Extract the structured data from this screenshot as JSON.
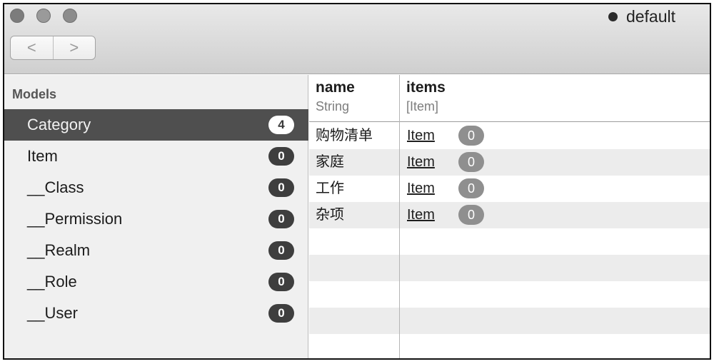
{
  "window": {
    "realm_name": "default"
  },
  "toolbar": {
    "back_glyph": "<",
    "forward_glyph": ">"
  },
  "sidebar": {
    "title": "Models",
    "models": [
      {
        "label": "Category",
        "count": "4",
        "selected": true
      },
      {
        "label": "Item",
        "count": "0",
        "selected": false
      },
      {
        "label": "__Class",
        "count": "0",
        "selected": false
      },
      {
        "label": "__Permission",
        "count": "0",
        "selected": false
      },
      {
        "label": "__Realm",
        "count": "0",
        "selected": false
      },
      {
        "label": "__Role",
        "count": "0",
        "selected": false
      },
      {
        "label": "__User",
        "count": "0",
        "selected": false
      }
    ]
  },
  "table": {
    "columns": [
      {
        "name": "name",
        "type": "String"
      },
      {
        "name": "items",
        "type": "[Item]"
      }
    ],
    "rows": [
      {
        "name": "购物清单",
        "items_link": "Item",
        "items_count": "0"
      },
      {
        "name": "家庭",
        "items_link": "Item",
        "items_count": "0"
      },
      {
        "name": "工作",
        "items_link": "Item",
        "items_count": "0"
      },
      {
        "name": "杂项",
        "items_link": "Item",
        "items_count": "0"
      }
    ]
  },
  "colors": {
    "selected_row": "#4f4f4f",
    "badge": "#3e3e3e",
    "count_pill": "#8f8f8f",
    "stripe": "#ececec"
  }
}
